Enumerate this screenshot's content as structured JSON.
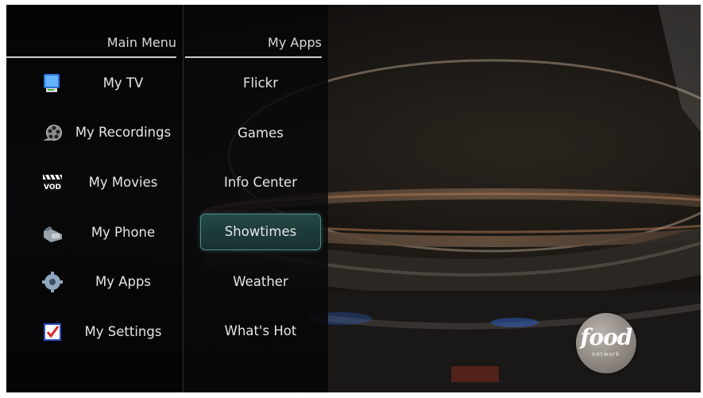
{
  "main_menu": {
    "title": "Main Menu",
    "items": [
      {
        "label": "My TV",
        "icon": "tv-icon"
      },
      {
        "label": "My Recordings",
        "icon": "film-reel-icon"
      },
      {
        "label": "My Movies",
        "icon": "vod-clapperboard-icon"
      },
      {
        "label": "My Phone",
        "icon": "phone-icon"
      },
      {
        "label": "My Apps",
        "icon": "gear-icon"
      },
      {
        "label": "My Settings",
        "icon": "checklist-icon"
      }
    ]
  },
  "apps_menu": {
    "title": "My Apps",
    "items": [
      {
        "label": "Flickr"
      },
      {
        "label": "Games"
      },
      {
        "label": "Info Center"
      },
      {
        "label": "Showtimes",
        "selected": true
      },
      {
        "label": "Weather"
      },
      {
        "label": "What's Hot"
      }
    ]
  },
  "channel_logo": {
    "word": "food",
    "sub": "network"
  },
  "colors": {
    "selection_fill": "#1d3b3a",
    "selection_border": "#4d8d88",
    "text": "#e6e6e6"
  }
}
